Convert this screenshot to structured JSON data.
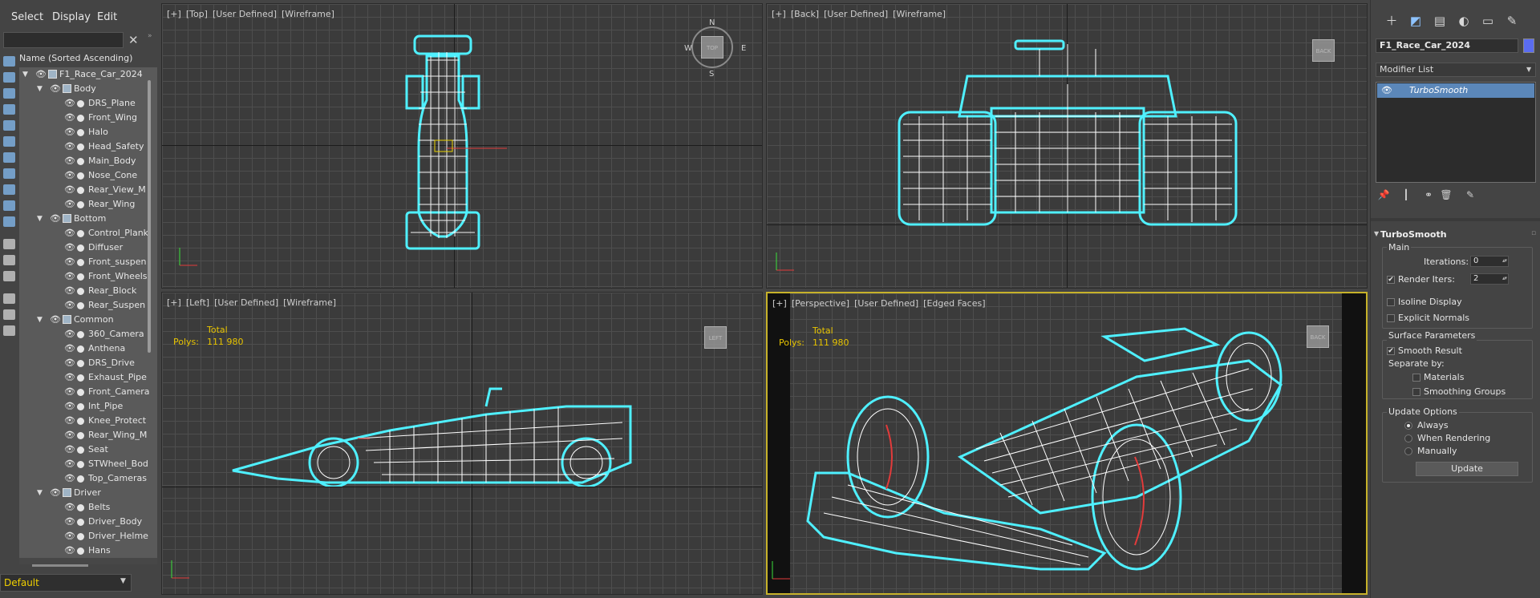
{
  "menu": {
    "select": "Select",
    "display": "Display",
    "edit": "Edit"
  },
  "explorer": {
    "filter_clear": "✕",
    "column_header": "Name (Sorted Ascending)",
    "root": "F1_Race_Car_2024",
    "groups": [
      {
        "name": "Body",
        "items": [
          "DRS_Plane",
          "Front_Wing",
          "Halo",
          "Head_Safety",
          "Main_Body",
          "Nose_Cone",
          "Rear_View_M",
          "Rear_Wing"
        ]
      },
      {
        "name": "Bottom",
        "items": [
          "Control_Plank",
          "Diffuser",
          "Front_suspen",
          "Front_Wheels",
          "Rear_Block",
          "Rear_Suspen"
        ]
      },
      {
        "name": "Common",
        "items": [
          "360_Camera",
          "Anthena",
          "DRS_Drive",
          "Exhaust_Pipe",
          "Front_Camera",
          "Int_Pipe",
          "Knee_Protect",
          "Rear_Wing_M",
          "Seat",
          "STWheel_Bod",
          "Top_Cameras"
        ]
      },
      {
        "name": "Driver",
        "items": [
          "Belts",
          "Driver_Body",
          "Driver_Helme",
          "Hans"
        ]
      }
    ],
    "layer": "Default"
  },
  "viewports": {
    "top": {
      "plus": "[+]",
      "view": "[Top]",
      "mode": "[User Defined]",
      "shading": "[Wireframe]",
      "compass": {
        "n": "N",
        "s": "S",
        "e": "E",
        "w": "W"
      },
      "cube": "TOP"
    },
    "back": {
      "plus": "[+]",
      "view": "[Back]",
      "mode": "[User Defined]",
      "shading": "[Wireframe]",
      "cube": "BACK"
    },
    "left": {
      "plus": "[+]",
      "view": "[Left]",
      "mode": "[User Defined]",
      "shading": "[Wireframe]",
      "cube": "LEFT",
      "stats_total": "Total",
      "stats_polys_label": "Polys:",
      "stats_polys": "111 980"
    },
    "persp": {
      "plus": "[+]",
      "view": "[Perspective]",
      "mode": "[User Defined]",
      "shading": "[Edged Faces]",
      "cube": "BACK",
      "stats_total": "Total",
      "stats_polys_label": "Polys:",
      "stats_polys": "111 980"
    }
  },
  "command_panel": {
    "object_name": "F1_Race_Car_2024",
    "modifier_list": "Modifier List",
    "stack_item": "TurboSmooth",
    "rollout_title": "TurboSmooth",
    "main_label": "Main",
    "iterations_label": "Iterations:",
    "iterations_value": "0",
    "render_iters_label": "Render Iters:",
    "render_iters_value": "2",
    "isoline_label": "Isoline Display",
    "explicit_normals_label": "Explicit Normals",
    "surface_params_label": "Surface Parameters",
    "smooth_result_label": "Smooth Result",
    "separate_by_label": "Separate by:",
    "materials_label": "Materials",
    "smoothing_groups_label": "Smoothing Groups",
    "update_options_label": "Update Options",
    "always_label": "Always",
    "when_rendering_label": "When Rendering",
    "manually_label": "Manually",
    "update_button": "Update",
    "render_iters_checked": true,
    "smooth_result_checked": true,
    "update_mode": "Always"
  },
  "colors": {
    "accent_select": "#5b87b9",
    "stat_text": "#e8c400",
    "layer_text": "#f0d000",
    "wire": "#ffffff",
    "wire_outline": "#4ff0ff",
    "persp_border": "#c7b22a"
  }
}
